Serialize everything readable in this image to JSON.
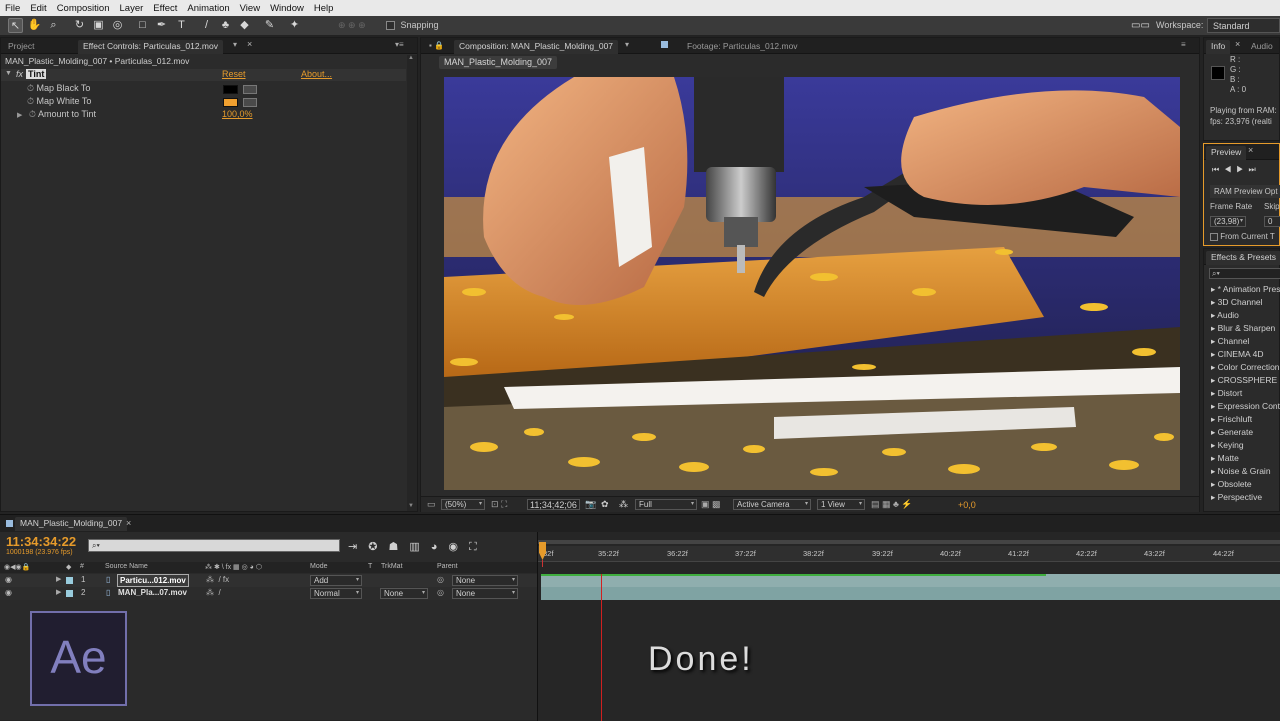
{
  "menu": [
    "File",
    "Edit",
    "Composition",
    "Layer",
    "Effect",
    "Animation",
    "View",
    "Window",
    "Help"
  ],
  "toolbar": {
    "snapping_label": "Snapping",
    "workspace_label": "Workspace:",
    "workspace_value": "Standard"
  },
  "left_panel": {
    "tabs": [
      "Project",
      "Effect Controls: Particulas_012.mov"
    ],
    "breadcrumb": "MAN_Plastic_Molding_007 • Particulas_012.mov",
    "effect_name": "Tint",
    "fx_label": "fx",
    "reset_label": "Reset",
    "about_label": "About...",
    "properties": [
      {
        "name": "Map Black To",
        "color": "#000000"
      },
      {
        "name": "Map White To",
        "color": "#f0a030"
      },
      {
        "name": "Amount to Tint",
        "value": "100,0%"
      }
    ]
  },
  "comp_panel": {
    "tabs": [
      "Composition: MAN_Plastic_Molding_007",
      "Footage: Particulas_012.mov"
    ],
    "comp_chip": "MAN_Plastic_Molding_007",
    "bottom": {
      "zoom": "(50%)",
      "timecode": "11;34;42;06",
      "resolution": "Full",
      "camera": "Active Camera",
      "view": "1 View",
      "exposure": "+0,0"
    }
  },
  "info_panel": {
    "tabs": [
      "Info",
      "Audio"
    ],
    "channels": [
      "R :",
      "G :",
      "B :",
      "A : 0"
    ],
    "playing": "Playing from RAM:",
    "fps": "fps: 23,976 (realti"
  },
  "preview_panel": {
    "tab": "Preview",
    "ram_preview": "RAM Preview Opt",
    "frame_rate_label": "Frame Rate",
    "skip_label": "Skip",
    "frame_rate_value": "(23,98)",
    "skip_value": "0",
    "from_current": "From Current T"
  },
  "effects_panel": {
    "tab": "Effects & Presets",
    "items": [
      "* Animation Pres",
      "3D Channel",
      "Audio",
      "Blur & Sharpen",
      "Channel",
      "CINEMA 4D",
      "Color Correction",
      "CROSSPHERE",
      "Distort",
      "Expression Cont",
      "Frischluft",
      "Generate",
      "Keying",
      "Matte",
      "Noise & Grain",
      "Obsolete",
      "Perspective"
    ]
  },
  "timeline": {
    "tab": "MAN_Plastic_Molding_007",
    "timecode": "11:34:34:22",
    "frame_info": "1000198 (23.976 fps)",
    "columns": {
      "hash": "#",
      "source": "Source Name",
      "mode": "Mode",
      "t": "T",
      "trkmat": "TrkMat",
      "parent": "Parent"
    },
    "layers": [
      {
        "num": "1",
        "name": "Particu...012.mov",
        "mode": "Add",
        "trkmat": "",
        "parent": "None"
      },
      {
        "num": "2",
        "name": "MAN_Pla...07.mov",
        "mode": "Normal",
        "trkmat": "None",
        "parent": "None"
      }
    ],
    "ruler": [
      "32f",
      "35:22f",
      "36:22f",
      "37:22f",
      "38:22f",
      "39:22f",
      "40:22f",
      "41:22f",
      "42:22f",
      "43:22f",
      "44:22f"
    ]
  },
  "overlay": {
    "logo": "Ae",
    "done_text": "Done!"
  },
  "colors": {
    "accent": "#e69b2b",
    "ae_purple": "#9999ff",
    "track_bar": "#8aaaa8"
  }
}
